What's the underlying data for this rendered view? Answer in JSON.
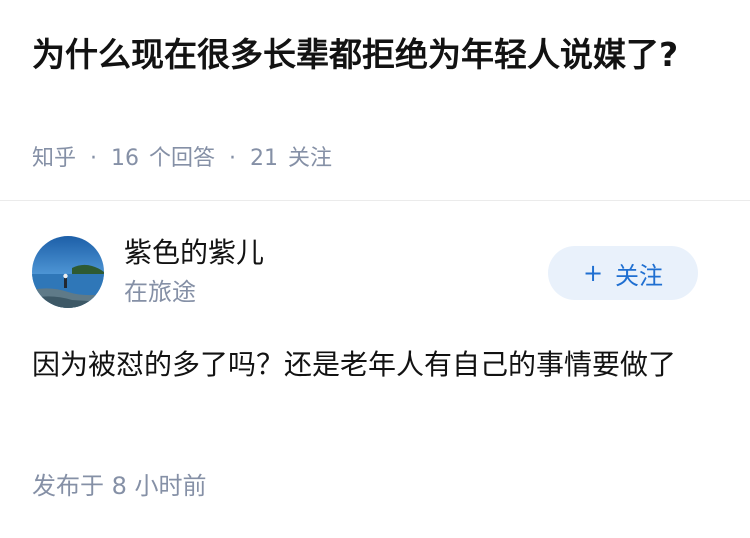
{
  "question": {
    "title": "为什么现在很多长辈都拒绝为年轻人说媒了?",
    "source": "知乎",
    "meta_separator": "·",
    "answer_count": "16",
    "answer_unit": "个回答",
    "follow_count": "21",
    "follow_unit": "关注"
  },
  "answer": {
    "author_name": "紫色的紫儿",
    "author_bio": "在旅途",
    "follow_button_label": "关注",
    "follow_button_icon": "plus-icon",
    "content": "因为被怼的多了吗？还是老年人有自己的事情要做了",
    "time_prefix": "发布于",
    "time_value": "8 小时前"
  },
  "colors": {
    "text_primary": "#121212",
    "text_secondary": "#8590a6",
    "accent": "#1f6fd1",
    "button_bg": "#e9f1fb",
    "divider": "#ebebeb"
  }
}
